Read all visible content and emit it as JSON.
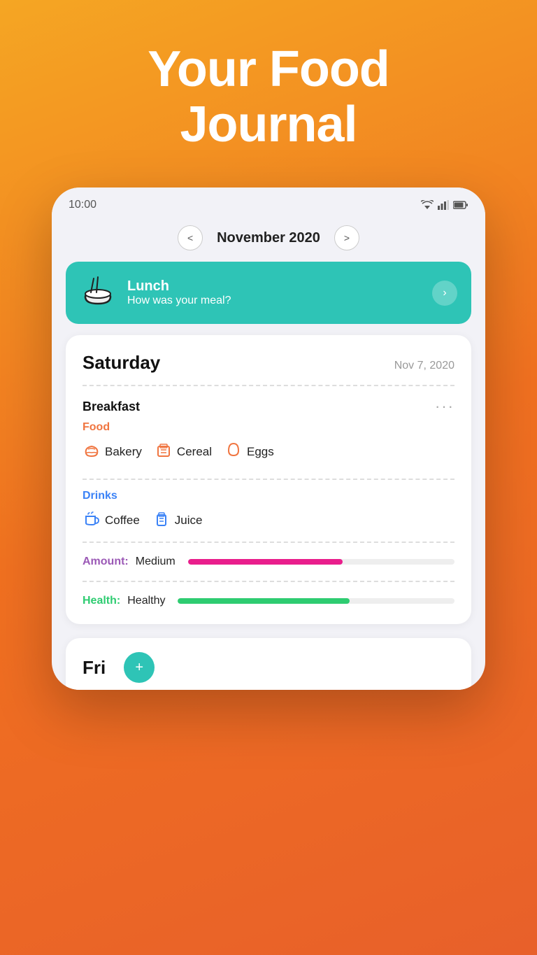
{
  "hero": {
    "title_line1": "Your Food",
    "title_line2": "Journal"
  },
  "status_bar": {
    "time": "10:00"
  },
  "month_nav": {
    "label": "November 2020",
    "prev_label": "<",
    "next_label": ">"
  },
  "lunch_banner": {
    "meal_label": "Lunch",
    "prompt": "How was your meal?"
  },
  "day_card": {
    "day": "Saturday",
    "date": "Nov 7, 2020",
    "breakfast": {
      "title": "Breakfast",
      "food_label": "Food",
      "food_items": [
        {
          "name": "Bakery",
          "icon": "🥖"
        },
        {
          "name": "Cereal",
          "icon": "🥣"
        },
        {
          "name": "Eggs",
          "icon": "🥚"
        }
      ],
      "drinks_label": "Drinks",
      "drink_items": [
        {
          "name": "Coffee",
          "icon": "☕"
        },
        {
          "name": "Juice",
          "icon": "🧃"
        }
      ],
      "amount_label": "Amount:",
      "amount_value": "Medium",
      "health_label": "Health:",
      "health_value": "Healthy"
    }
  },
  "bottom_peek": {
    "day": "Fri"
  }
}
